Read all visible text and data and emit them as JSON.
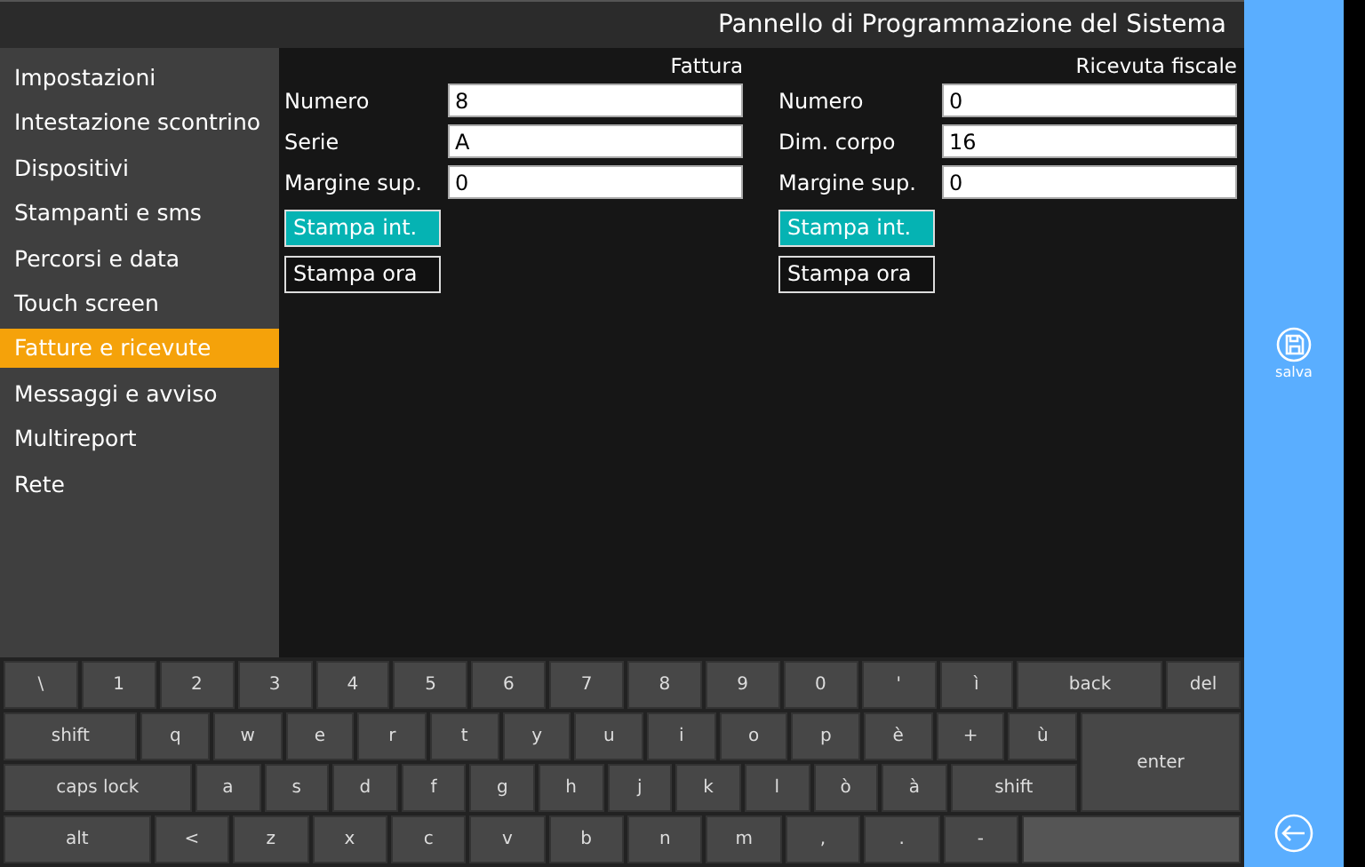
{
  "window": {
    "title": "Pannello di Programmazione del Sistema"
  },
  "sidebar": {
    "items": [
      {
        "label": "Impostazioni",
        "selected": false
      },
      {
        "label": "Intestazione scontrino",
        "selected": false
      },
      {
        "label": "Dispositivi",
        "selected": false
      },
      {
        "label": "Stampanti e sms",
        "selected": false
      },
      {
        "label": "Percorsi e data",
        "selected": false
      },
      {
        "label": "Touch screen",
        "selected": false
      },
      {
        "label": "Fatture e ricevute",
        "selected": true
      },
      {
        "label": "Messaggi e avviso",
        "selected": false
      },
      {
        "label": "Multireport",
        "selected": false
      },
      {
        "label": "Rete",
        "selected": false
      }
    ]
  },
  "sections": [
    {
      "title": "Fattura",
      "fields": [
        {
          "label": "Numero",
          "value": "8"
        },
        {
          "label": "Serie",
          "value": "A"
        },
        {
          "label": "Margine sup.",
          "value": "0"
        }
      ],
      "toggles": [
        {
          "label": "Stampa int.",
          "selected": true
        },
        {
          "label": "Stampa ora",
          "selected": false
        }
      ]
    },
    {
      "title": "Ricevuta fiscale",
      "fields": [
        {
          "label": "Numero",
          "value": "0"
        },
        {
          "label": "Dim. corpo",
          "value": "16"
        },
        {
          "label": "Margine sup.",
          "value": "0"
        }
      ],
      "toggles": [
        {
          "label": "Stampa int.",
          "selected": true
        },
        {
          "label": "Stampa ora",
          "selected": false
        }
      ]
    }
  ],
  "save_button": {
    "label": "salva"
  },
  "keyboard": {
    "row_1": [
      {
        "label": "\\",
        "kind": "key"
      },
      {
        "label": "1",
        "kind": "key"
      },
      {
        "label": "2",
        "kind": "key"
      },
      {
        "label": "3",
        "kind": "key"
      },
      {
        "label": "4",
        "kind": "key"
      },
      {
        "label": "5",
        "kind": "key"
      },
      {
        "label": "6",
        "kind": "key"
      },
      {
        "label": "7",
        "kind": "key"
      },
      {
        "label": "8",
        "kind": "key"
      },
      {
        "label": "9",
        "kind": "key"
      },
      {
        "label": "0",
        "kind": "key"
      },
      {
        "label": "'",
        "kind": "key"
      },
      {
        "label": "ì",
        "kind": "key"
      },
      {
        "label": "back",
        "kind": "wide"
      },
      {
        "label": "del",
        "kind": "key"
      }
    ],
    "row_2": [
      {
        "label": "shift",
        "kind": "wide"
      },
      {
        "label": "q",
        "kind": "key"
      },
      {
        "label": "w",
        "kind": "key"
      },
      {
        "label": "e",
        "kind": "key"
      },
      {
        "label": "r",
        "kind": "key"
      },
      {
        "label": "t",
        "kind": "key"
      },
      {
        "label": "y",
        "kind": "key"
      },
      {
        "label": "u",
        "kind": "key"
      },
      {
        "label": "i",
        "kind": "key"
      },
      {
        "label": "o",
        "kind": "key"
      },
      {
        "label": "p",
        "kind": "key"
      },
      {
        "label": "è",
        "kind": "key"
      },
      {
        "label": "+",
        "kind": "key"
      },
      {
        "label": "ù",
        "kind": "key"
      }
    ],
    "row_3": [
      {
        "label": "caps lock",
        "kind": "xwide"
      },
      {
        "label": "a",
        "kind": "key"
      },
      {
        "label": "s",
        "kind": "key"
      },
      {
        "label": "d",
        "kind": "key"
      },
      {
        "label": "f",
        "kind": "key"
      },
      {
        "label": "g",
        "kind": "key"
      },
      {
        "label": "h",
        "kind": "key"
      },
      {
        "label": "j",
        "kind": "key"
      },
      {
        "label": "k",
        "kind": "key"
      },
      {
        "label": "l",
        "kind": "key"
      },
      {
        "label": "ò",
        "kind": "key"
      },
      {
        "label": "à",
        "kind": "key"
      },
      {
        "label": "shift",
        "kind": "wide"
      }
    ],
    "enter": {
      "label": "enter"
    },
    "row_4": [
      {
        "label": "alt",
        "kind": "wide"
      },
      {
        "label": "<",
        "kind": "key"
      },
      {
        "label": "z",
        "kind": "key"
      },
      {
        "label": "x",
        "kind": "key"
      },
      {
        "label": "c",
        "kind": "key"
      },
      {
        "label": "v",
        "kind": "key"
      },
      {
        "label": "b",
        "kind": "key"
      },
      {
        "label": "n",
        "kind": "key"
      },
      {
        "label": "m",
        "kind": "key"
      },
      {
        "label": ",",
        "kind": "key"
      },
      {
        "label": ".",
        "kind": "key"
      },
      {
        "label": "-",
        "kind": "key"
      },
      {
        "kind": "space"
      }
    ]
  }
}
